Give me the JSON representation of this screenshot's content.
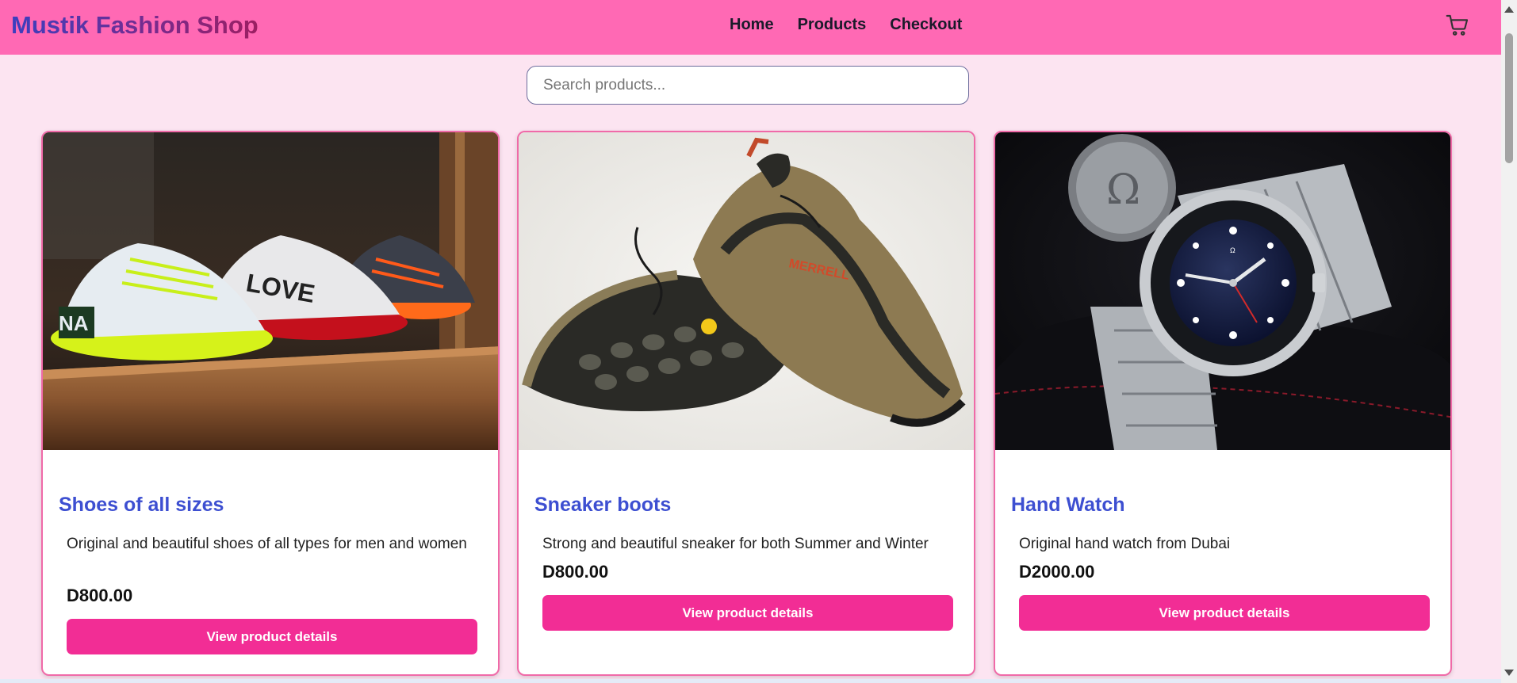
{
  "brand": "Mustik Fashion Shop",
  "nav": {
    "home": "Home",
    "products": "Products",
    "checkout": "Checkout"
  },
  "search": {
    "placeholder": "Search products..."
  },
  "products": [
    {
      "title": "Shoes of all sizes",
      "description": "Original and beautiful shoes of all types for men and women",
      "price": "D800.00",
      "button": "View product details"
    },
    {
      "title": "Sneaker boots",
      "description": "Strong and beautiful sneaker for both Summer and Winter",
      "price": "D800.00",
      "button": "View product details"
    },
    {
      "title": "Hand Watch",
      "description": "Original hand watch from Dubai",
      "price": "D2000.00",
      "button": "View product details"
    }
  ],
  "colors": {
    "navbar": "#ff69b4",
    "page_background": "#fce4f1",
    "button": "#f22d95",
    "title": "#3d4fd1"
  },
  "icons": {
    "cart": "shopping-cart-icon"
  }
}
